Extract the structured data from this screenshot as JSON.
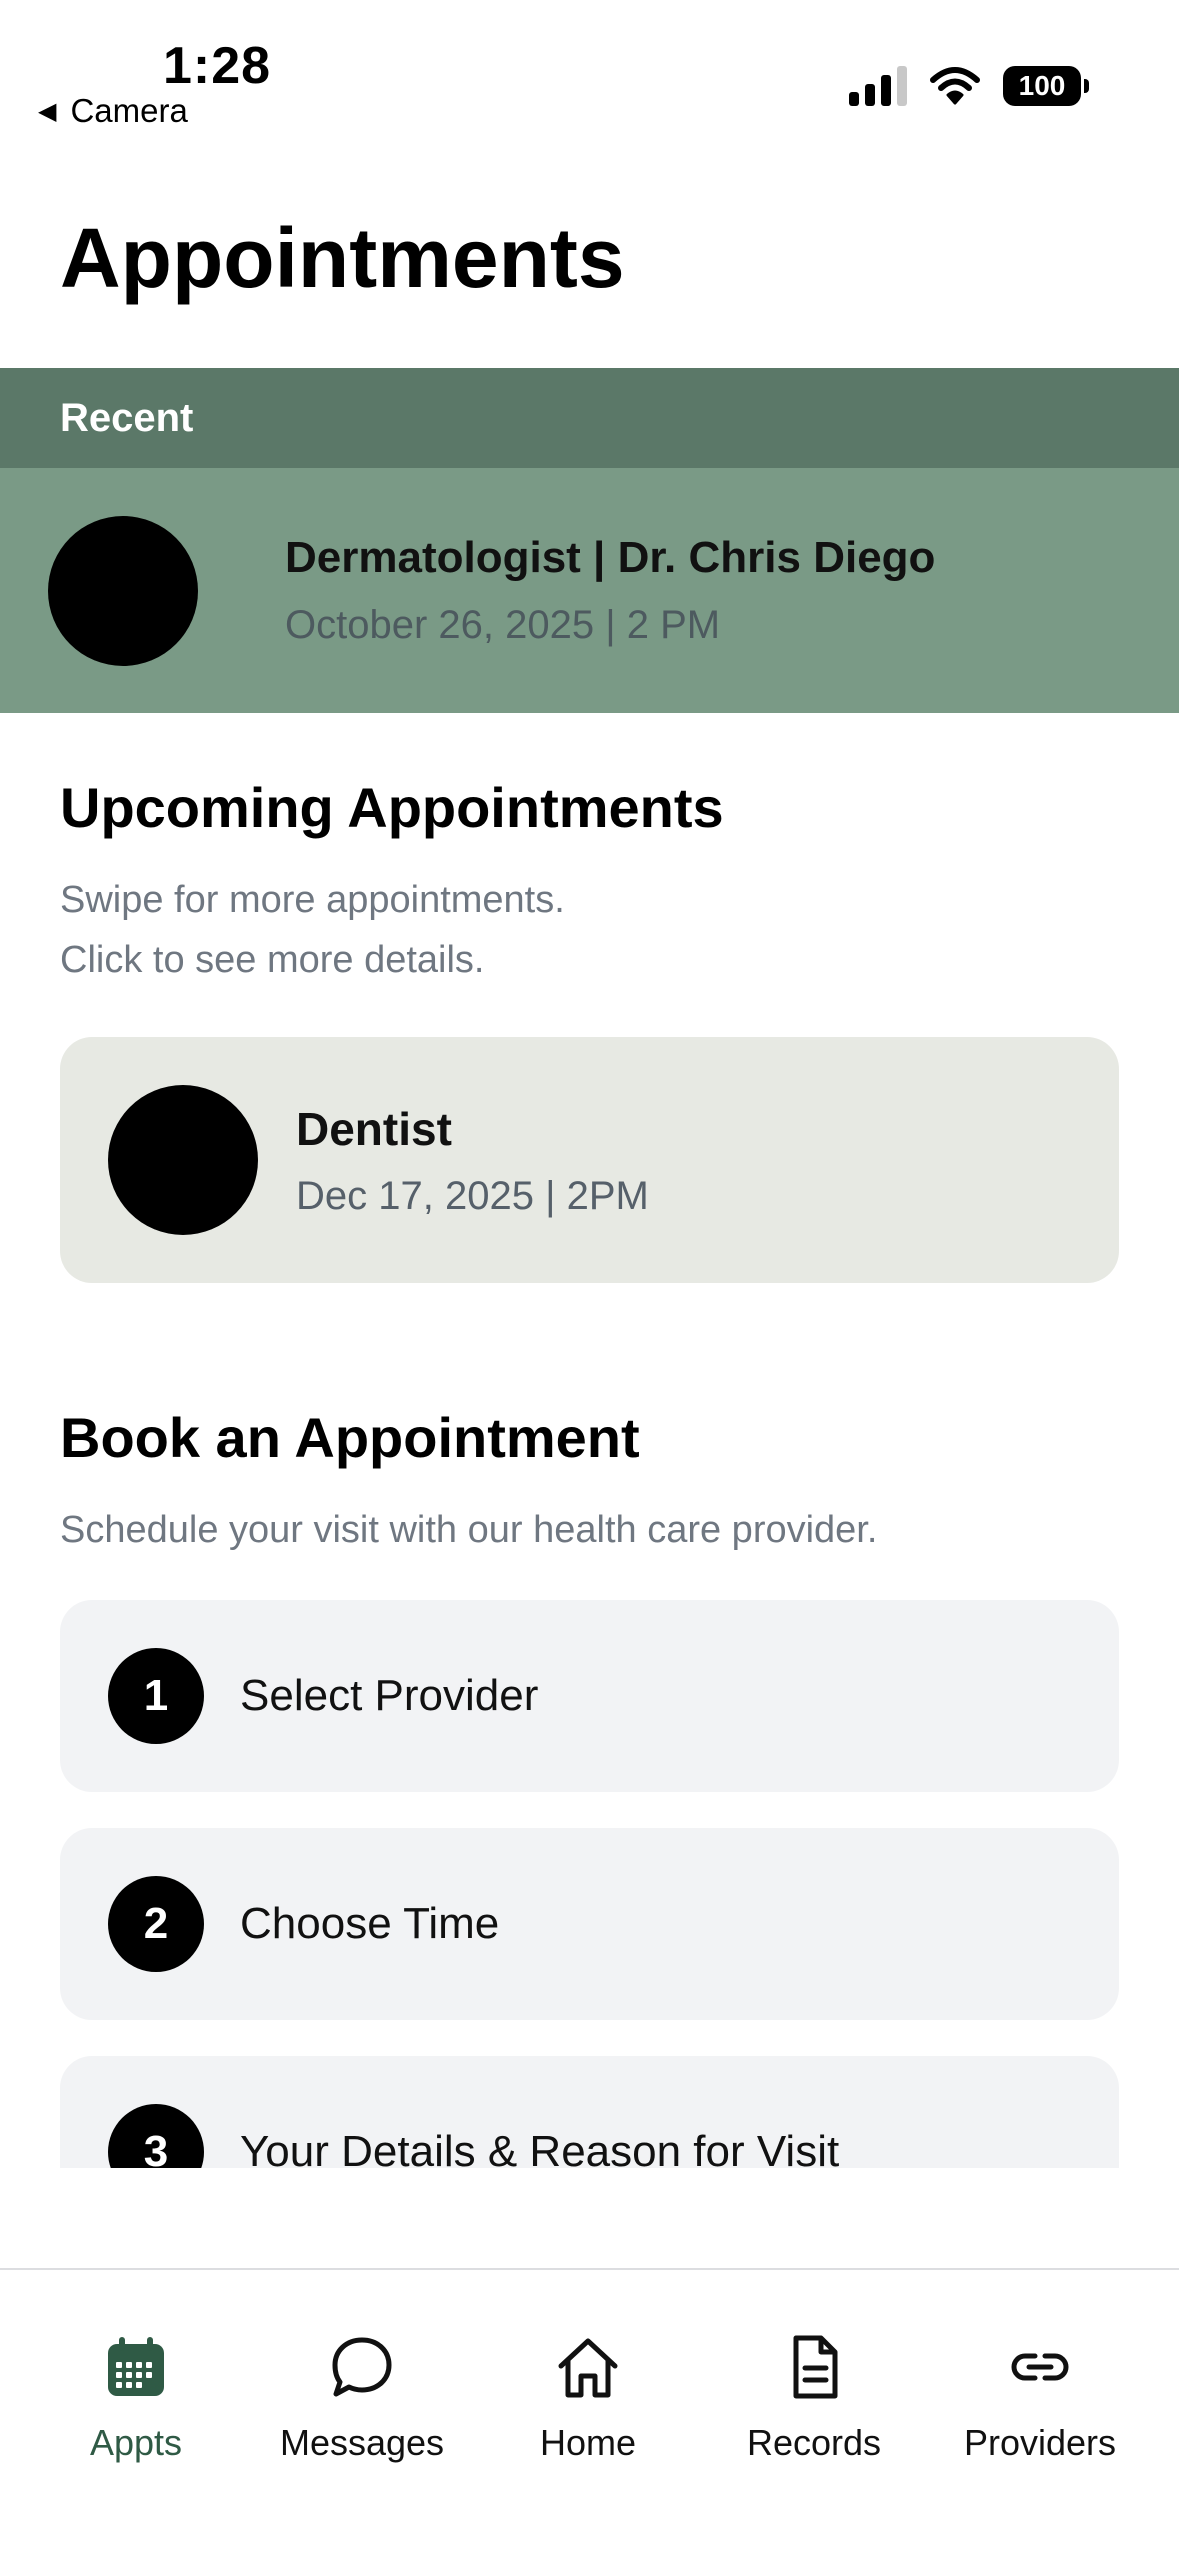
{
  "status_bar": {
    "time": "1:28",
    "back_label": "Camera",
    "battery": "100"
  },
  "page": {
    "title": "Appointments"
  },
  "recent": {
    "header": "Recent",
    "item": {
      "title": "Dermatologist | Dr. Chris Diego",
      "datetime": "October 26, 2025 | 2 PM"
    }
  },
  "upcoming": {
    "title": "Upcoming Appointments",
    "subtitle_line1": "Swipe for more appointments.",
    "subtitle_line2": "Click to see more details.",
    "card": {
      "title": "Dentist",
      "datetime": "Dec 17, 2025 | 2PM"
    }
  },
  "book": {
    "title": "Book an Appointment",
    "subtitle": "Schedule your visit with our health care provider.",
    "steps": [
      {
        "number": "1",
        "label": "Select Provider"
      },
      {
        "number": "2",
        "label": "Choose Time"
      },
      {
        "number": "3",
        "label": "Your Details & Reason for Visit"
      }
    ]
  },
  "tabbar": {
    "items": [
      {
        "label": "Appts",
        "icon": "calendar-icon",
        "active": true
      },
      {
        "label": "Messages",
        "icon": "chat-bubble-icon",
        "active": false
      },
      {
        "label": "Home",
        "icon": "house-icon",
        "active": false
      },
      {
        "label": "Records",
        "icon": "document-icon",
        "active": false
      },
      {
        "label": "Providers",
        "icon": "link-icon",
        "active": false
      }
    ]
  },
  "colors": {
    "recent_header_bg": "#5b7868",
    "recent_row_bg": "#7a9a86",
    "upcoming_card_bg": "#e7e9e3",
    "step_card_bg": "#f2f3f5",
    "active_tab": "#2f5a45"
  }
}
